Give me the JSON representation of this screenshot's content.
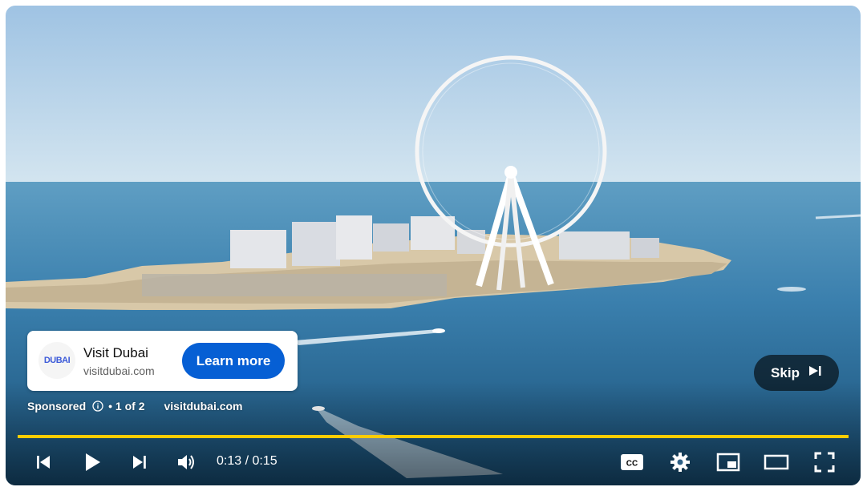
{
  "ad": {
    "logo_text": "DUBAI",
    "title": "Visit Dubai",
    "domain": "visitdubai.com",
    "cta_label": "Learn more"
  },
  "sponsored": {
    "label": "Sponsored",
    "info_icon": "info-icon",
    "position": "• 1 of 2",
    "domain": "visitdubai.com"
  },
  "skip": {
    "label": "Skip",
    "icon": "skip-next-icon"
  },
  "progress": {
    "fraction": 1.0,
    "color": "#ffcc00"
  },
  "player": {
    "time_display": "0:13 / 0:15",
    "controls": [
      "previous-icon",
      "play-icon",
      "next-icon",
      "volume-icon",
      "cc-icon",
      "settings-icon",
      "miniplayer-icon",
      "theater-icon",
      "fullscreen-icon"
    ]
  },
  "colors": {
    "cta": "#065fd4",
    "progress": "#ffcc00",
    "overlay": "#000000"
  }
}
